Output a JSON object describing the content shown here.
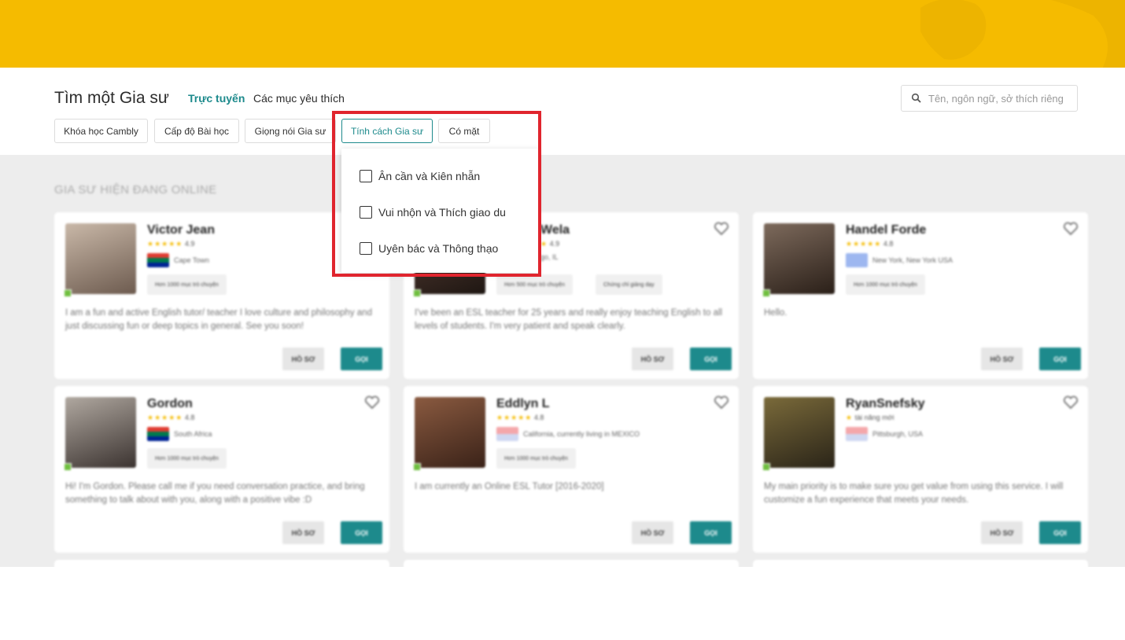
{
  "header": {
    "title": "Tìm một Gia sư",
    "nav_online": "Trực tuyến",
    "nav_favorites": "Các mục yêu thích",
    "search_placeholder": "Tên, ngôn ngữ, sở thích riêng"
  },
  "filters": [
    {
      "label": "Khóa học Cambly"
    },
    {
      "label": "Cấp độ Bài học"
    },
    {
      "label": "Giọng nói Gia sư"
    },
    {
      "label": "Tính cách Gia sư",
      "active": true
    },
    {
      "label": "Có mặt"
    }
  ],
  "dropdown": {
    "options": [
      {
        "label": "Ân cần và Kiên nhẫn",
        "checked": false
      },
      {
        "label": "Vui nhộn và Thích giao du",
        "checked": false
      },
      {
        "label": "Uyên bác và Thông thạo",
        "checked": false
      }
    ]
  },
  "section_title": "GIA SƯ HIỆN ĐANG ONLINE",
  "tutors": [
    {
      "name": "Victor Jean",
      "rating": "4.9",
      "location": "Cape Town",
      "tags": [
        "Hơn 1000 mục trò chuyện"
      ],
      "description": "I am a fun and active English tutor/ teacher I love culture and philosophy and just discussing fun or deep topics in general. See you soon!",
      "profile_label": "HỒ SƠ",
      "call_label": "GỌI"
    },
    {
      "name": "Wela",
      "rating": "4.9",
      "location": "go, IL",
      "tags": [
        "Hơn 500 mục trò chuyện",
        "Chứng chỉ giảng dạy"
      ],
      "description": "I've been an ESL teacher for 25 years and really enjoy teaching English to all levels of students. I'm very patient and speak clearly.",
      "profile_label": "HỒ SƠ",
      "call_label": "GỌI"
    },
    {
      "name": "Handel Forde",
      "rating": "4.8",
      "location": "New York, New York USA",
      "tags": [
        "Hơn 1000 mục trò chuyện"
      ],
      "description": "Hello.",
      "profile_label": "HỒ SƠ",
      "call_label": "GỌI"
    },
    {
      "name": "Gordon",
      "rating": "4.8",
      "location": "South Africa",
      "tags": [
        "Hơn 1000 mục trò chuyện"
      ],
      "description": "Hi! I'm Gordon. Please call me if you need conversation practice, and bring something to talk about with you, along with a positive vibe :D",
      "profile_label": "HỒ SƠ",
      "call_label": "GỌI"
    },
    {
      "name": "Eddlyn L",
      "rating": "4.8",
      "location": "California, currently living in MEXICO",
      "tags": [
        "Hơn 1000 mục trò chuyện"
      ],
      "description": "I am currently an Online ESL Tutor [2016-2020]",
      "profile_label": "HỒ SƠ",
      "call_label": "GỌI"
    },
    {
      "name": "RyanSnefsky",
      "rating": "tài năng mới",
      "location": "Pittsburgh, USA",
      "tags": [],
      "description": "My main priority is to make sure you get value from using this service. I will customize a fun experience that meets your needs.",
      "profile_label": "HỒ SƠ",
      "call_label": "GỌI"
    }
  ],
  "colors": {
    "banner": "#f5bb00",
    "accent": "#1d8a8c",
    "highlight": "#e0252e",
    "online": "#6fbf3f"
  }
}
